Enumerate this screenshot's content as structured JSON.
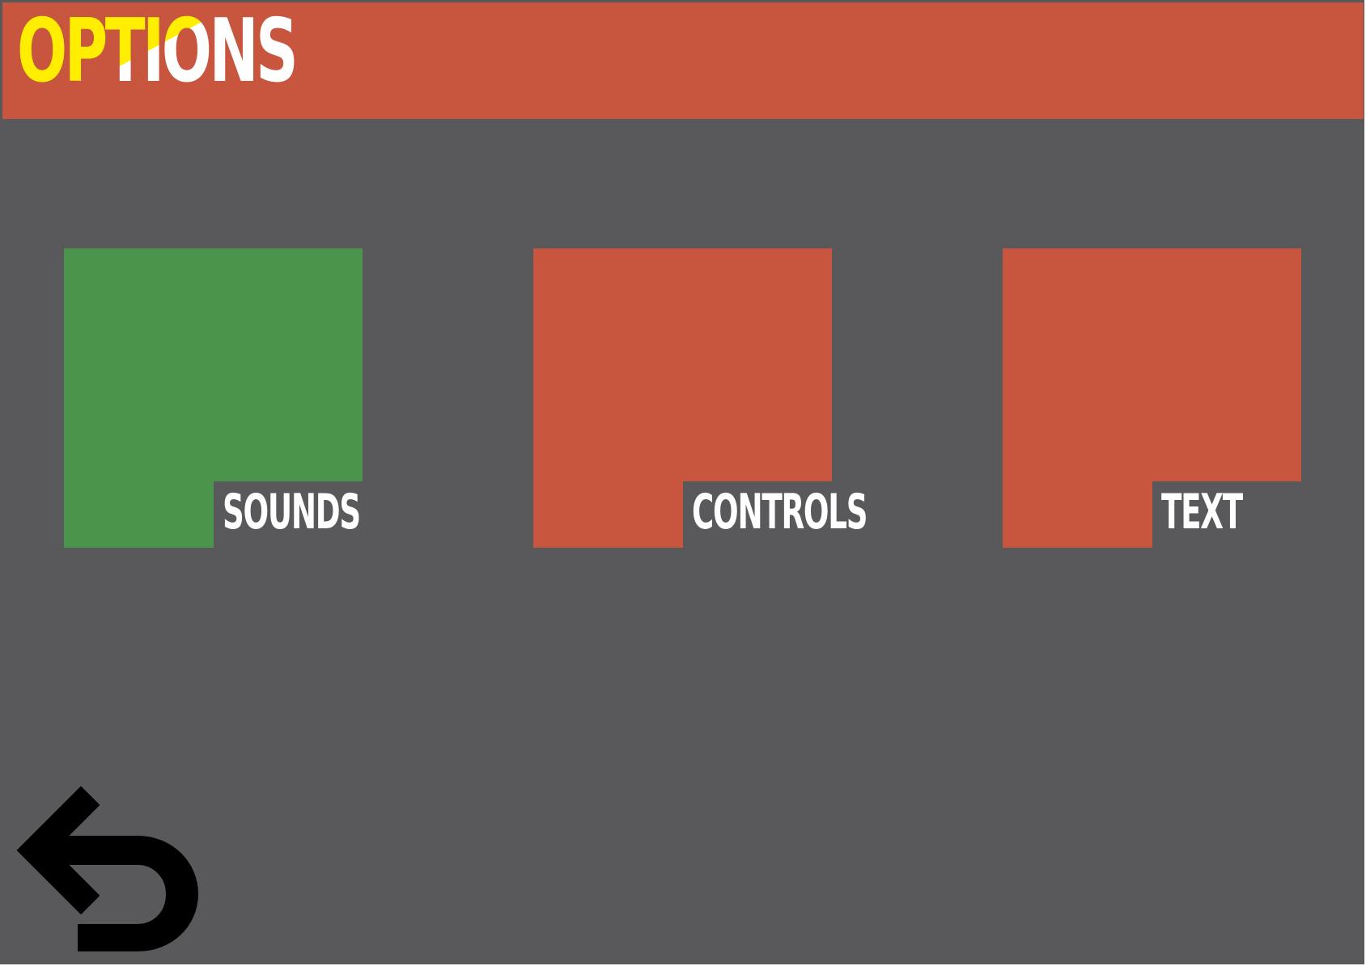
{
  "header": {
    "title": "OPTIONS"
  },
  "tiles": [
    {
      "label": "SOUNDS",
      "state": "selected",
      "color": "#4a954b"
    },
    {
      "label": "CONTROLS",
      "state": "normal",
      "color": "#c8553e"
    },
    {
      "label": "TEXT",
      "state": "normal",
      "color": "#c8553e"
    }
  ],
  "back_button": {
    "icon": "back-arrow-icon"
  },
  "colors": {
    "background": "#59595b",
    "header": "#c8553e",
    "title_accent": "#ffee00",
    "text": "#ffffff",
    "icon": "#000000"
  }
}
